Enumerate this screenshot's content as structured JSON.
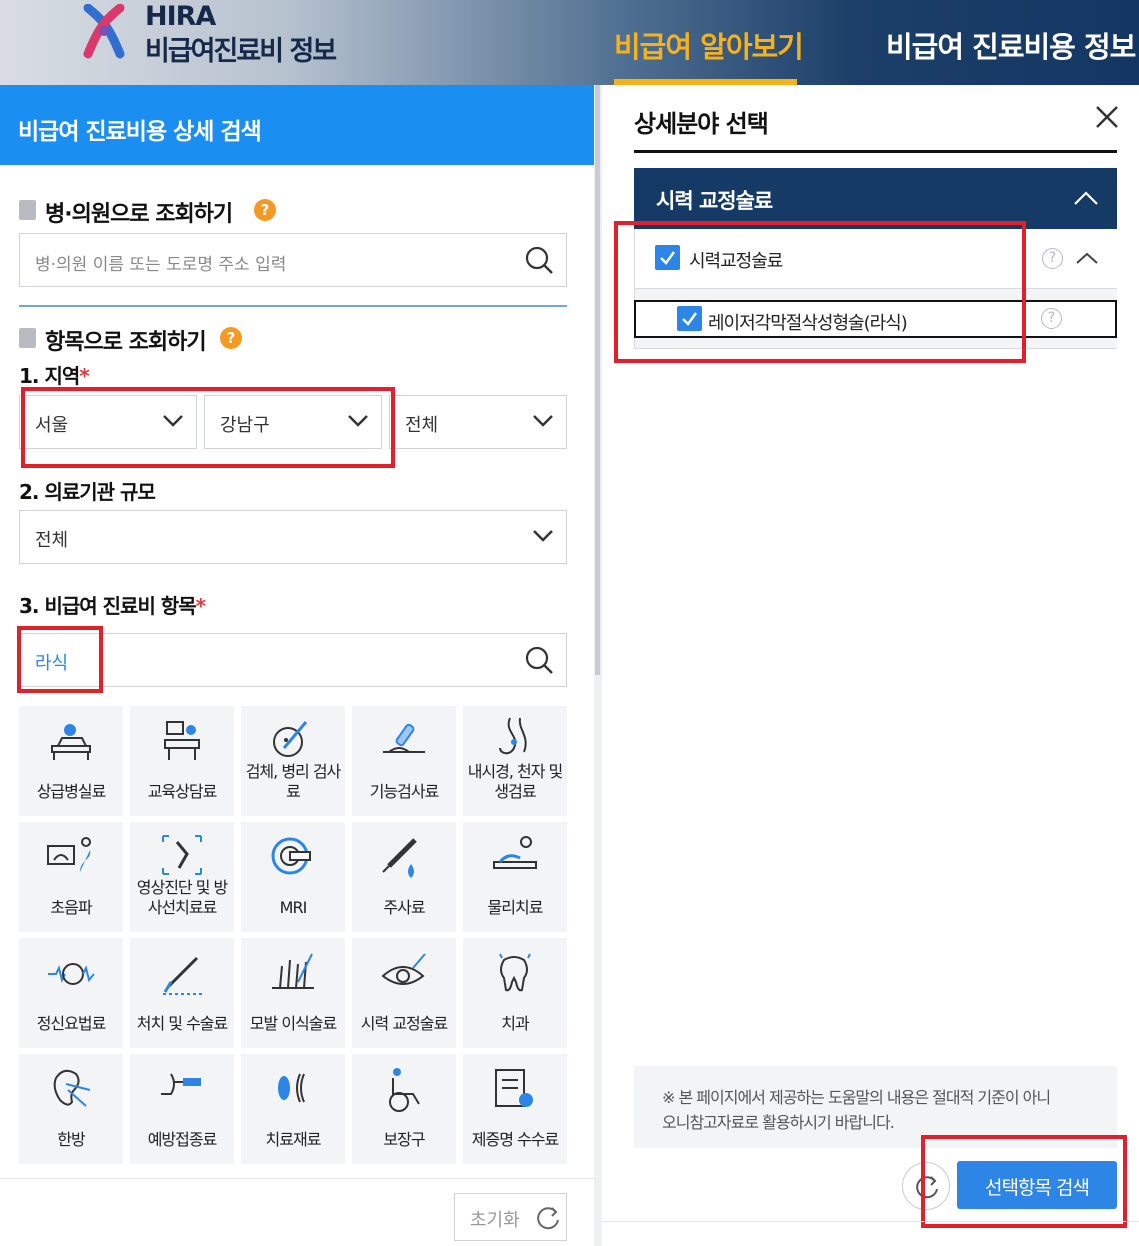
{
  "header": {
    "logo_line1": "HIRA",
    "logo_line2": "비급여진료비 정보",
    "nav_active": "비급여 알아보기",
    "nav_other": "비급여 진료비용 정보",
    "accent": "#f6b21b"
  },
  "left": {
    "title": "비급여 진료비용 상세 검색",
    "hospital_section": {
      "heading": "병·의원으로 조회하기",
      "help": "?",
      "placeholder": "병·의원 이름 또는 도로명 주소 입력"
    },
    "item_section": {
      "heading": "항목으로 조회하기",
      "help": "?"
    },
    "region": {
      "label": "1. 지역",
      "required": "*",
      "sido": "서울",
      "sigungu": "강남구",
      "dong": "전체"
    },
    "scale": {
      "label": "2. 의료기관 규모",
      "value": "전체"
    },
    "item": {
      "label": "3. 비급여 진료비 항목",
      "required": "*",
      "value": "라식"
    },
    "categories": [
      {
        "label": "상급병실료",
        "icon": "hospital-bed-icon"
      },
      {
        "label": "교육상담료",
        "icon": "counseling-icon"
      },
      {
        "label": "검체, 병리 검사료",
        "icon": "specimen-test-icon"
      },
      {
        "label": "기능검사료",
        "icon": "function-test-icon"
      },
      {
        "label": "내시경, 천자 및 생검료",
        "icon": "endoscope-icon"
      },
      {
        "label": "초음파",
        "icon": "ultrasound-icon"
      },
      {
        "label": "영상진단 및 방사선치료료",
        "icon": "xray-icon"
      },
      {
        "label": "MRI",
        "icon": "mri-icon"
      },
      {
        "label": "주사료",
        "icon": "syringe-icon"
      },
      {
        "label": "물리치료",
        "icon": "physical-therapy-icon"
      },
      {
        "label": "정신요법료",
        "icon": "brain-icon"
      },
      {
        "label": "처치 및 수술료",
        "icon": "scalpel-icon"
      },
      {
        "label": "모발 이식술료",
        "icon": "hair-transplant-icon"
      },
      {
        "label": "시력 교정술료",
        "icon": "eye-icon"
      },
      {
        "label": "치과",
        "icon": "tooth-icon"
      },
      {
        "label": "한방",
        "icon": "ear-acupuncture-icon"
      },
      {
        "label": "예방접종료",
        "icon": "vaccine-icon"
      },
      {
        "label": "치료재료",
        "icon": "lens-icon"
      },
      {
        "label": "보장구",
        "icon": "wheelchair-icon"
      },
      {
        "label": "제증명 수수료",
        "icon": "certificate-icon"
      }
    ],
    "reset_label": "초기화"
  },
  "right": {
    "title": "상세분야 선택",
    "group": "시력 교정술료",
    "items": [
      {
        "label": "시력교정술료",
        "checked": true
      },
      {
        "label": "레이저각막절삭성형술(라식)",
        "checked": true
      }
    ],
    "help": "?",
    "note_line1": "※ 본 페이지에서 제공하는 도움말의 내용은 절대적 기준이 아니",
    "note_line2": "오니참고자료로 활용하시기 바랍니다.",
    "search_button": "선택항목 검색",
    "button_color": "#2d86e6"
  }
}
